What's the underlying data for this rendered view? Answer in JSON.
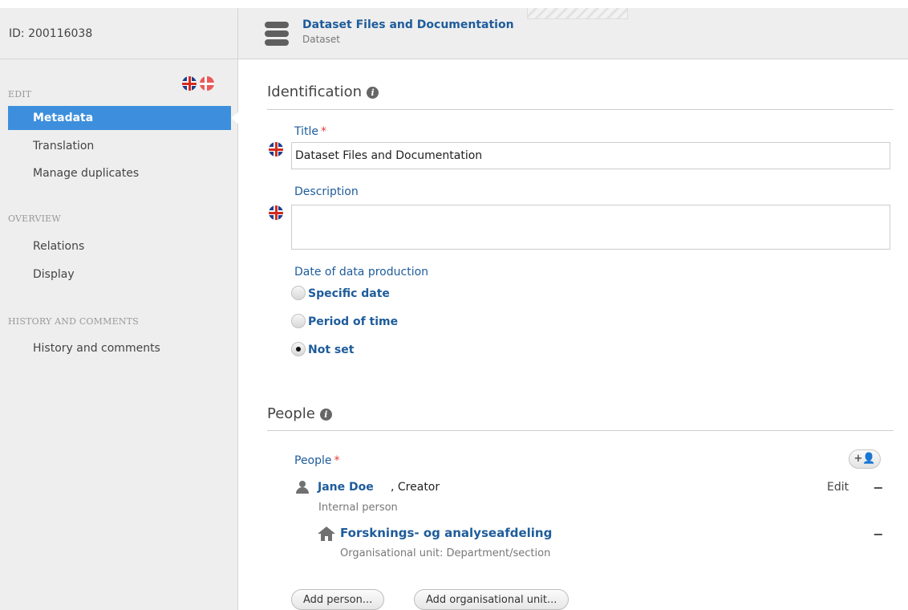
{
  "header": {
    "record_id": "ID: 200116038",
    "content_title": "Dataset Files and Documentation",
    "content_type": "Dataset",
    "content_icon": "database-icon"
  },
  "sidebar": {
    "edit_heading": "EDIT",
    "languages": [
      "english-flag-icon",
      "danish-flag-icon"
    ],
    "edit_items": [
      {
        "label": "Metadata",
        "active": true
      },
      {
        "label": "Translation"
      },
      {
        "label": "Manage duplicates"
      }
    ],
    "overview_heading": "OVERVIEW",
    "overview_items": [
      {
        "label": "Relations"
      },
      {
        "label": "Display"
      }
    ],
    "history_heading": "HISTORY AND COMMENTS",
    "history_items": [
      {
        "label": "History and comments"
      }
    ]
  },
  "identification": {
    "heading": "Identification",
    "title_label": "Title",
    "required_marker": "*",
    "title_value": "Dataset Files and Documentation",
    "description_label": "Description",
    "description_value": "",
    "date_label": "Date of data production",
    "date_options": [
      {
        "label": "Specific date",
        "checked": false
      },
      {
        "label": "Period of time",
        "checked": false
      },
      {
        "label": "Not set",
        "checked": true
      }
    ]
  },
  "people": {
    "heading": "People",
    "label": "People",
    "required_marker": "*",
    "add_icon_label": "+👤",
    "person_name": "Jane Doe",
    "person_role": ", Creator",
    "person_type": "Internal person",
    "edit_label": "Edit",
    "remove_label": "−",
    "org_name": "Forsknings- og analyseafdeling",
    "org_type": "Organisational unit: Department/section",
    "add_person_label": "Add person...",
    "add_org_label": "Add organisational unit..."
  },
  "colors": {
    "link_blue": "#1e5c9b",
    "active_blue": "#3d8fdd",
    "required_red": "#e23b3b",
    "sidebar_bg": "#eeeeee"
  }
}
